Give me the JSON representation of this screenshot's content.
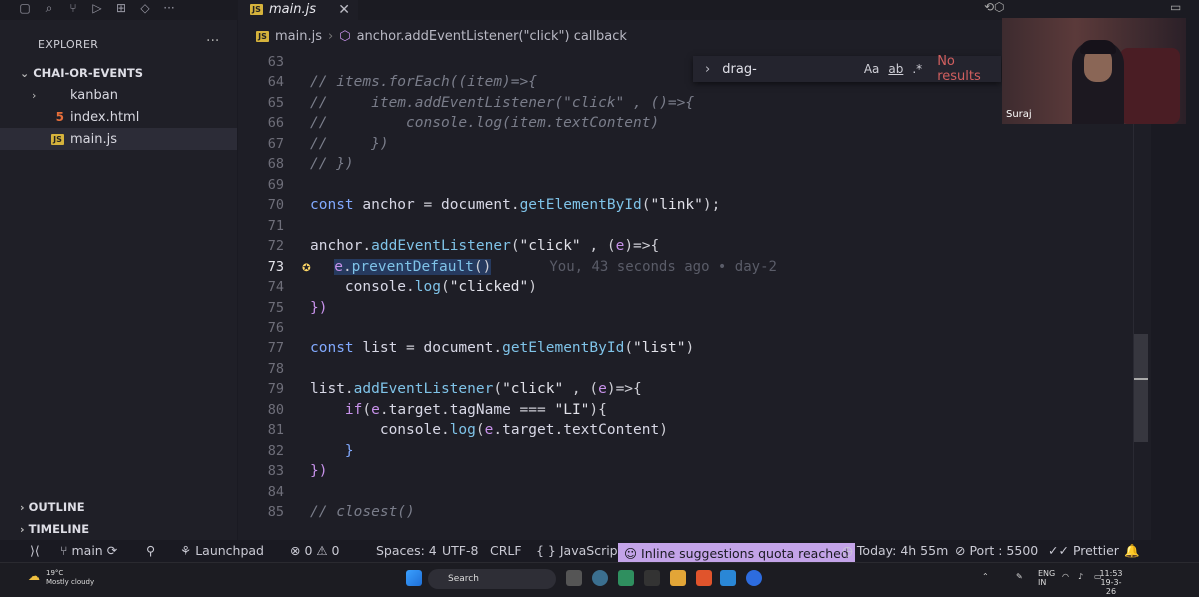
{
  "tab": {
    "badge": "JS",
    "name": "main.js",
    "close": "✕"
  },
  "window_icons": {
    "left": "⟲⬡",
    "right": "▭"
  },
  "explorer": {
    "title": "EXPLORER",
    "more": "···",
    "folder": "CHAI-OR-EVENTS",
    "items": [
      {
        "label": "kanban",
        "kind": "folder"
      },
      {
        "label": "index.html",
        "kind": "html"
      },
      {
        "label": "main.js",
        "kind": "js",
        "selected": true
      }
    ],
    "outline": "OUTLINE",
    "timeline": "TIMELINE"
  },
  "breadcrumb": {
    "file": "main.js",
    "symbol": "anchor.addEventListener(\"click\") callback"
  },
  "find": {
    "value": "drag-",
    "case": "Aa",
    "word": "ab",
    "regex": ".*",
    "result": "No results"
  },
  "code": {
    "l63": "63",
    "l64": "64",
    "l65": "65",
    "l66": "66",
    "l67": "67",
    "l68": "68",
    "l69": "69",
    "l70": "70",
    "l71": "71",
    "l72": "72",
    "l73": "73",
    "l74": "74",
    "l75": "75",
    "l76": "76",
    "l77": "77",
    "l78": "78",
    "l79": "79",
    "l80": "80",
    "l81": "81",
    "l82": "82",
    "l83": "83",
    "l84": "84",
    "l85": "85",
    "c64": "// items.forEach((item)=>{",
    "c65": "//     item.addEventListener(\"click\" , ()=>{",
    "c66": "//         console.log(item.textContent)",
    "c67": "//     })",
    "c68": "// })",
    "blame": "You, 43 seconds ago • day-2",
    "c85": "// closest()"
  },
  "status": {
    "branch": "main",
    "launchpad": "Launchpad",
    "problems": "⊗ 0 ⚠ 0",
    "spaces": "Spaces: 4",
    "encoding": "UTF-8",
    "eol": "CRLF",
    "language": "{ } JavaScript",
    "quota": "Inline suggestions quota reached",
    "today": "Today: 4h 55m",
    "port": "Port : 5500",
    "prettier": "Prettier"
  },
  "webcam": {
    "name": "Suraj"
  },
  "taskbar": {
    "temp": "19°C",
    "weather": "Mostly cloudy",
    "search": "Search",
    "lang1": "ENG",
    "lang2": "IN",
    "time": "11:53",
    "date": "19-3-26"
  }
}
